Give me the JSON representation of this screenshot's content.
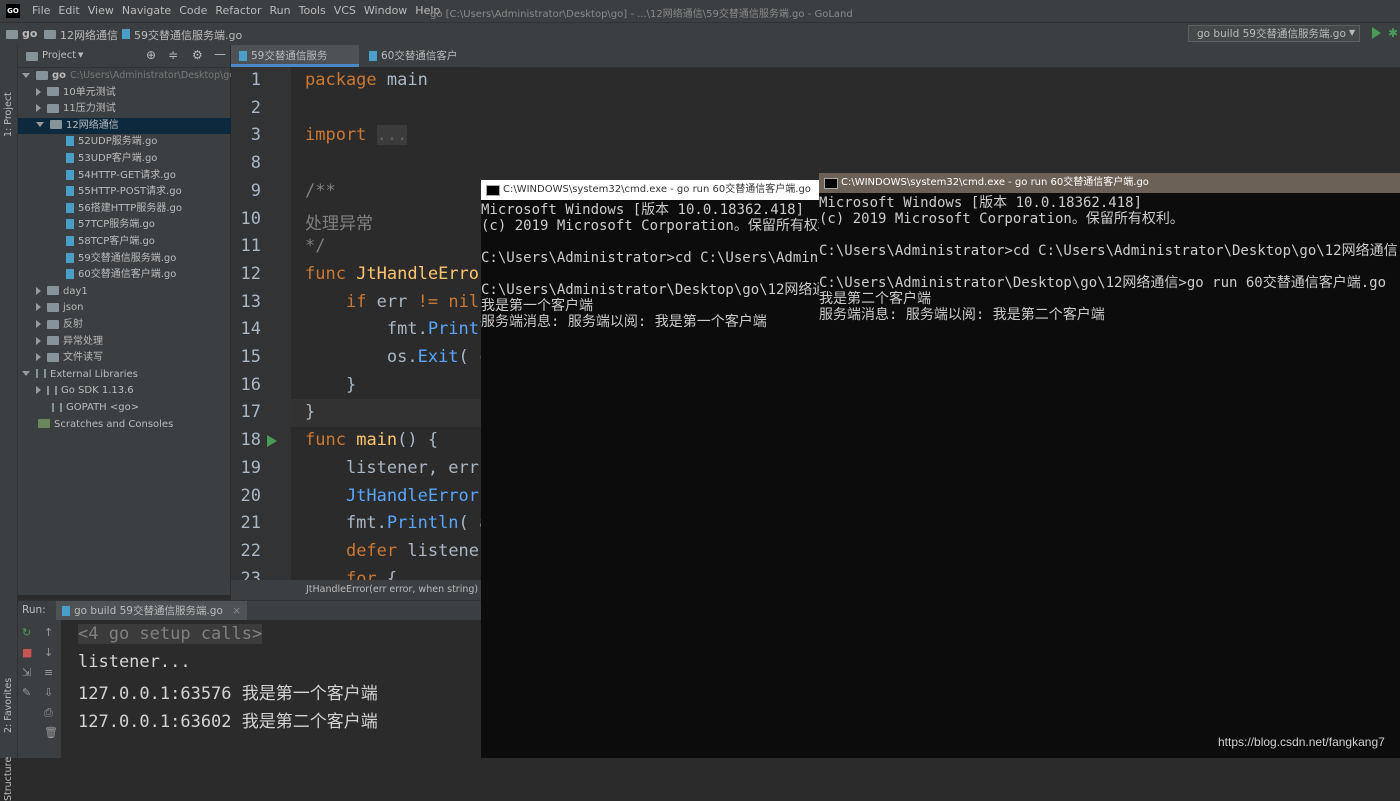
{
  "window": {
    "logo": "GO",
    "title": "go [C:\\Users\\Administrator\\Desktop\\go] - ...\\12网络通信\\59交替通信服务端.go - GoLand",
    "menu": [
      "File",
      "Edit",
      "View",
      "Navigate",
      "Code",
      "Refactor",
      "Run",
      "Tools",
      "VCS",
      "Window",
      "Help"
    ]
  },
  "breadcrumb": [
    "go",
    "12网络通信",
    "59交替通信服务端.go"
  ],
  "run_config": "go build 59交替通信服务端.go",
  "left_stripe": [
    "1: Project",
    "2: Favorites",
    "Structure"
  ],
  "project": {
    "header": "Project",
    "root_name": "go",
    "root_path": "C:\\Users\\Administrator\\Desktop\\go",
    "items": [
      {
        "label": "10单元测试",
        "type": "folder",
        "level": 1
      },
      {
        "label": "11压力测试",
        "type": "folder",
        "level": 1
      },
      {
        "label": "12网络通信",
        "type": "folder-open",
        "level": 1,
        "selected": true
      },
      {
        "label": "52UDP服务端.go",
        "type": "file",
        "level": 2
      },
      {
        "label": "53UDP客户端.go",
        "type": "file",
        "level": 2
      },
      {
        "label": "54HTTP-GET请求.go",
        "type": "file",
        "level": 2
      },
      {
        "label": "55HTTP-POST请求.go",
        "type": "file",
        "level": 2
      },
      {
        "label": "56搭建HTTP服务器.go",
        "type": "file",
        "level": 2
      },
      {
        "label": "57TCP服务端.go",
        "type": "file",
        "level": 2
      },
      {
        "label": "58TCP客户端.go",
        "type": "file",
        "level": 2
      },
      {
        "label": "59交替通信服务端.go",
        "type": "file",
        "level": 2
      },
      {
        "label": "60交替通信客户端.go",
        "type": "file",
        "level": 2
      },
      {
        "label": "day1",
        "type": "folder",
        "level": 1
      },
      {
        "label": "json",
        "type": "folder",
        "level": 1
      },
      {
        "label": "反射",
        "type": "folder",
        "level": 1
      },
      {
        "label": "异常处理",
        "type": "folder",
        "level": 1
      },
      {
        "label": "文件读写",
        "type": "folder",
        "level": 1
      },
      {
        "label": "External Libraries",
        "type": "lib-open",
        "level": 0
      },
      {
        "label": "Go SDK 1.13.6",
        "type": "lib",
        "level": 1
      },
      {
        "label": "GOPATH <go>",
        "type": "lib-leaf",
        "level": 1
      },
      {
        "label": "Scratches and Consoles",
        "type": "scratch",
        "level": 0
      }
    ]
  },
  "tabs": [
    {
      "label": "59交替通信服务端.go",
      "active": true
    },
    {
      "label": "60交替通信客户端.go",
      "active": false
    }
  ],
  "editor": {
    "lines": [
      {
        "n": "1",
        "segs": [
          [
            "kw",
            "package"
          ],
          [
            "p",
            " main"
          ]
        ]
      },
      {
        "n": "2",
        "segs": []
      },
      {
        "n": "3",
        "segs": [
          [
            "kw",
            "import"
          ],
          [
            "p",
            " "
          ],
          [
            "fold",
            "..."
          ]
        ]
      },
      {
        "n": "8",
        "segs": []
      },
      {
        "n": "9",
        "segs": [
          [
            "cm",
            "/**"
          ]
        ]
      },
      {
        "n": "10",
        "segs": [
          [
            "cm",
            "处理异常"
          ]
        ]
      },
      {
        "n": "11",
        "segs": [
          [
            "cm",
            "*/"
          ]
        ]
      },
      {
        "n": "12",
        "segs": [
          [
            "kw",
            "func"
          ],
          [
            "p",
            " "
          ],
          [
            "fn",
            "JtHandleError"
          ]
        ]
      },
      {
        "n": "13",
        "segs": [
          [
            "p",
            "    "
          ],
          [
            "kw",
            "if"
          ],
          [
            "p",
            " err "
          ],
          [
            "kw",
            "!="
          ],
          [
            "p",
            " "
          ],
          [
            "kw",
            "nil"
          ]
        ]
      },
      {
        "n": "14",
        "segs": [
          [
            "p",
            "        fmt."
          ],
          [
            "call",
            "Println"
          ]
        ]
      },
      {
        "n": "15",
        "segs": [
          [
            "p",
            "        os."
          ],
          [
            "call",
            "Exit"
          ],
          [
            "p",
            "( "
          ],
          [
            "cm",
            "c"
          ]
        ]
      },
      {
        "n": "16",
        "segs": [
          [
            "p",
            "    }"
          ]
        ]
      },
      {
        "n": "17",
        "segs": [
          [
            "p",
            "}"
          ]
        ]
      },
      {
        "n": "18",
        "segs": [
          [
            "kw",
            "func"
          ],
          [
            "p",
            " "
          ],
          [
            "fn",
            "main"
          ],
          [
            "p",
            "() {"
          ]
        ]
      },
      {
        "n": "19",
        "segs": [
          [
            "p",
            "    listener, err"
          ]
        ]
      },
      {
        "n": "20",
        "segs": [
          [
            "p",
            "    "
          ],
          [
            "call",
            "JtHandleError"
          ]
        ]
      },
      {
        "n": "21",
        "segs": [
          [
            "p",
            "    fmt."
          ],
          [
            "call",
            "Println"
          ],
          [
            "p",
            "( "
          ],
          [
            "cm",
            "a"
          ]
        ]
      },
      {
        "n": "22",
        "segs": [
          [
            "p",
            "    "
          ],
          [
            "kw",
            "defer"
          ],
          [
            "p",
            " listene"
          ]
        ]
      },
      {
        "n": "23",
        "segs": [
          [
            "p",
            "    "
          ],
          [
            "kw",
            "for"
          ],
          [
            "p",
            " {"
          ]
        ]
      }
    ],
    "hint": "JtHandleError(err error, when string)"
  },
  "run_panel": {
    "label": "Run:",
    "tab": "go build 59交替通信服务端.go",
    "output": [
      "<4 go setup calls>",
      "listener...",
      "127.0.0.1:63576 我是第一个客户端",
      "127.0.0.1:63602 我是第二个客户端"
    ]
  },
  "cmd1": {
    "title": "C:\\WINDOWS\\system32\\cmd.exe - go  run 60交替通信客户端.go",
    "lines": [
      "Microsoft Windows [版本 10.0.18362.418]",
      "(c) 2019 Microsoft Corporation。保留所有权利。",
      "",
      "C:\\Users\\Administrator>cd C:\\Users\\Administrator\\Desktop\\go\\12网络通信",
      "",
      "C:\\Users\\Administrator\\Desktop\\go\\12网络通信>go run 60交替通信客户端.go",
      "我是第一个客户端",
      "服务端消息: 服务端以阅: 我是第一个客户端"
    ]
  },
  "cmd2": {
    "title": "C:\\WINDOWS\\system32\\cmd.exe - go  run 60交替通信客户端.go",
    "lines": [
      "Microsoft Windows [版本 10.0.18362.418]",
      "(c) 2019 Microsoft Corporation。保留所有权利。",
      "",
      "C:\\Users\\Administrator>cd C:\\Users\\Administrator\\Desktop\\go\\12网络通信",
      "",
      "C:\\Users\\Administrator\\Desktop\\go\\12网络通信>go run 60交替通信客户端.go",
      "我是第二个客户端",
      "服务端消息: 服务端以阅: 我是第二个客户端"
    ]
  },
  "watermark": "https://blog.csdn.net/fangkang7"
}
